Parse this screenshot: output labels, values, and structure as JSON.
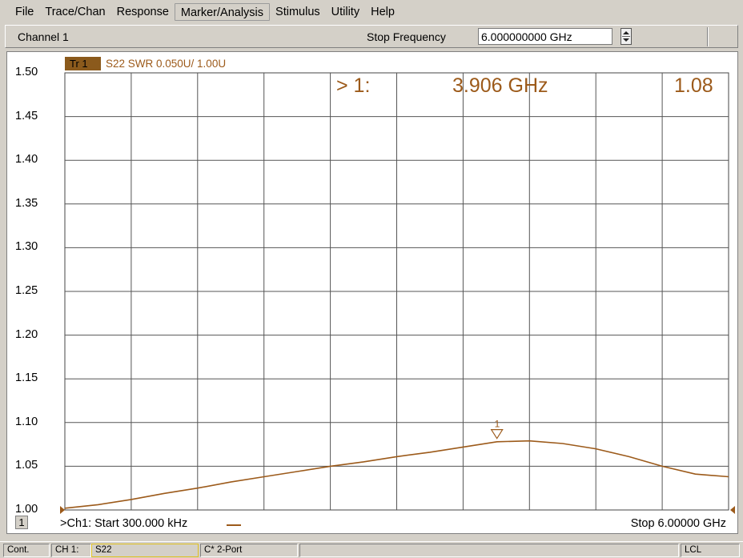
{
  "menu": {
    "items": [
      "File",
      "Trace/Chan",
      "Response",
      "Marker/Analysis",
      "Stimulus",
      "Utility",
      "Help"
    ]
  },
  "toolbar": {
    "channel_label": "Channel 1",
    "stop_label": "Stop Frequency",
    "stop_value": "6.000000000 GHz"
  },
  "trace": {
    "tab_label": "Tr 1",
    "description": "S22 SWR 0.050U/  1.00U",
    "color": "#9c5a1a"
  },
  "marker": {
    "prefix": "> 1:",
    "frequency": "3.906 GHz",
    "value": "1.08",
    "label": "1"
  },
  "footer": {
    "channel_num": "1",
    "start": ">Ch1: Start  300.000 kHz",
    "stop": "Stop  6.00000 GHz"
  },
  "statusbar": {
    "mode": "Cont.",
    "ch": "CH 1:",
    "param": "S22",
    "cal": "C* 2-Port",
    "remote": "LCL"
  },
  "chart_data": {
    "type": "line",
    "ylim": [
      1.0,
      1.5
    ],
    "xlim": [
      0.0003,
      6.0
    ],
    "yticks": [
      "1.50",
      "1.45",
      "1.40",
      "1.35",
      "1.30",
      "1.25",
      "1.20",
      "1.15",
      "1.10",
      "1.05",
      "1.00"
    ],
    "grid": true,
    "series": [
      {
        "x": [
          0.0003,
          0.3,
          0.6,
          0.9,
          1.2,
          1.5,
          1.8,
          2.1,
          2.4,
          2.7,
          3.0,
          3.3,
          3.6,
          3.906,
          4.2,
          4.5,
          4.8,
          5.1,
          5.4,
          5.7,
          6.0
        ],
        "values": [
          1.002,
          1.006,
          1.012,
          1.019,
          1.025,
          1.032,
          1.038,
          1.044,
          1.05,
          1.055,
          1.061,
          1.066,
          1.072,
          1.078,
          1.079,
          1.076,
          1.07,
          1.061,
          1.05,
          1.041,
          1.038
        ]
      }
    ]
  }
}
